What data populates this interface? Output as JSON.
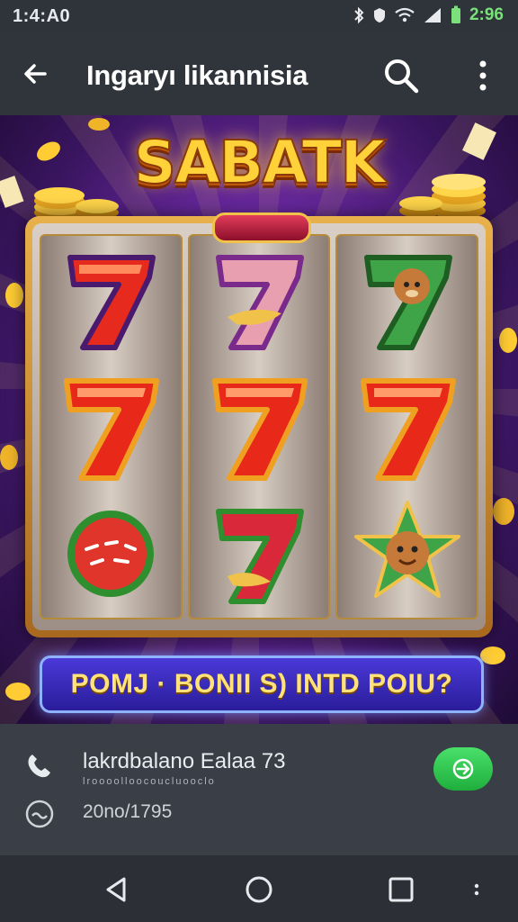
{
  "status": {
    "time": "1:4:A0",
    "clock": "2:96"
  },
  "appbar": {
    "title": "Ingaryı likannisia"
  },
  "banner": {
    "logo": "SABATK",
    "promo": "POMJ · BONII S) INTD POIU?"
  },
  "info": {
    "line1": "lakrdbalano Ealaa 73",
    "line1_sub": "lroooolloocoucluooclo",
    "line2": "20no/1795"
  },
  "colors": {
    "accent_green": "#2fc84c",
    "promo_blue": "#3a2bc0",
    "logo_gold": "#ffd23a"
  }
}
